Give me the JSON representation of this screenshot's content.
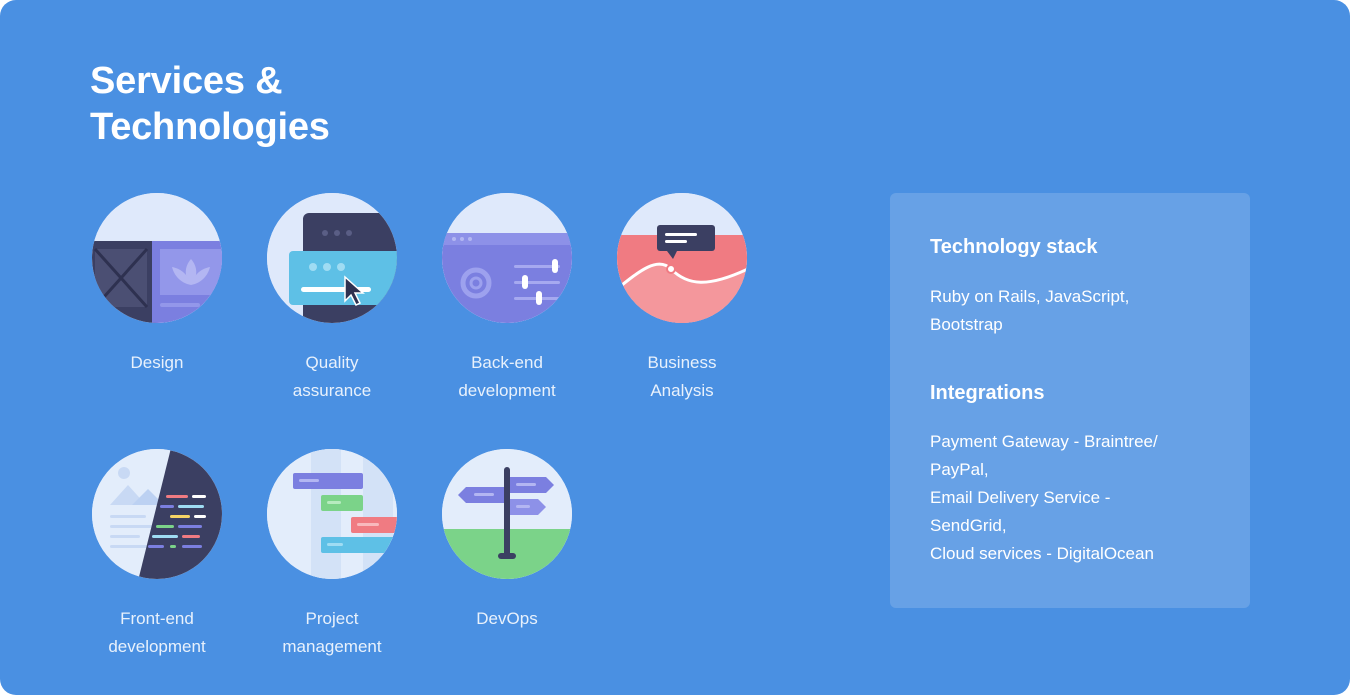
{
  "heading": {
    "line1": "Services &",
    "line2": "Technologies"
  },
  "services": [
    {
      "icon": "design-illustration-icon",
      "line1": "Design",
      "line2": ""
    },
    {
      "icon": "quality-assurance-illustration-icon",
      "line1": "Quality",
      "line2": "assurance"
    },
    {
      "icon": "backend-illustration-icon",
      "line1": "Back-end",
      "line2": "development"
    },
    {
      "icon": "business-analysis-illustration-icon",
      "line1": "Business",
      "line2": "Analysis"
    },
    {
      "icon": "frontend-illustration-icon",
      "line1": "Front-end",
      "line2": "development"
    },
    {
      "icon": "project-management-illustration-icon",
      "line1": "Project",
      "line2": "management"
    },
    {
      "icon": "devops-illustration-icon",
      "line1": "DevOps",
      "line2": ""
    }
  ],
  "panel": {
    "stack_title": "Technology stack",
    "stack_lines": [
      "Ruby on Rails, JavaScript,",
      "Bootstrap"
    ],
    "integrations_title": "Integrations",
    "integrations_lines": [
      "Payment Gateway - Braintree/",
      "PayPal,",
      "Email Delivery Service -",
      "SendGrid,",
      "Cloud services - DigitalOcean"
    ]
  },
  "colors": {
    "background": "#4a90e2",
    "panel": "rgba(255,255,255,0.16)",
    "text": "#ffffff"
  }
}
